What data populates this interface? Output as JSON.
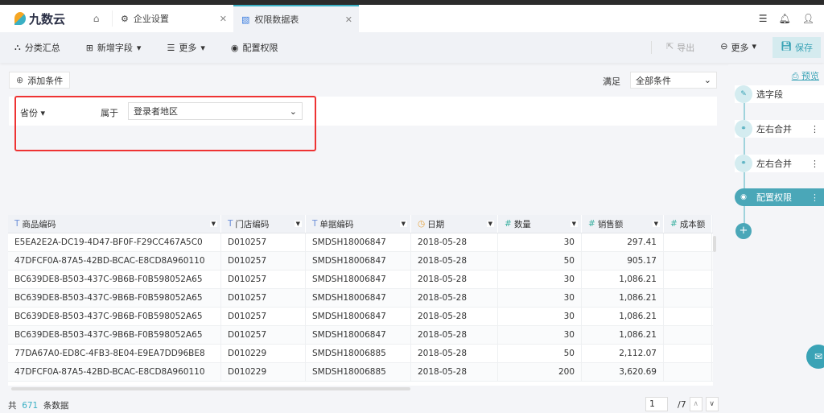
{
  "header": {
    "brand": "九数云",
    "tabs": [
      {
        "label": "企业设置",
        "icon": "gear-icon"
      },
      {
        "label": "权限数据表",
        "icon": "chart-icon",
        "active": true
      }
    ]
  },
  "toolbar": {
    "classify": "分类汇总",
    "add_field": "新增字段",
    "more": "更多",
    "config": "配置权限",
    "export": "导出",
    "more_right": "更多",
    "save": "保存"
  },
  "filter": {
    "add_condition": "添加条件",
    "satisfy": "满足",
    "satisfy_value": "全部条件",
    "field": "省份",
    "operator": "属于",
    "value": "登录者地区"
  },
  "table": {
    "columns": [
      {
        "label": "商品编码",
        "type": "text"
      },
      {
        "label": "门店编码",
        "type": "text"
      },
      {
        "label": "单据编码",
        "type": "text"
      },
      {
        "label": "日期",
        "type": "date"
      },
      {
        "label": "数量",
        "type": "number"
      },
      {
        "label": "销售额",
        "type": "number"
      },
      {
        "label": "成本额",
        "type": "number"
      }
    ],
    "rows": [
      [
        "E5EA2E2A-DC19-4D47-BF0F-F29CC467A5C0",
        "D010257",
        "SMDSH18006847",
        "2018-05-28",
        "30",
        "297.41",
        ""
      ],
      [
        "47DFCF0A-87A5-42BD-BCAC-E8CD8A960110",
        "D010257",
        "SMDSH18006847",
        "2018-05-28",
        "50",
        "905.17",
        ""
      ],
      [
        "BC639DE8-B503-437C-9B6B-F0B598052A65",
        "D010257",
        "SMDSH18006847",
        "2018-05-28",
        "30",
        "1,086.21",
        ""
      ],
      [
        "BC639DE8-B503-437C-9B6B-F0B598052A65",
        "D010257",
        "SMDSH18006847",
        "2018-05-28",
        "30",
        "1,086.21",
        ""
      ],
      [
        "BC639DE8-B503-437C-9B6B-F0B598052A65",
        "D010257",
        "SMDSH18006847",
        "2018-05-28",
        "30",
        "1,086.21",
        ""
      ],
      [
        "BC639DE8-B503-437C-9B6B-F0B598052A65",
        "D010257",
        "SMDSH18006847",
        "2018-05-28",
        "30",
        "1,086.21",
        ""
      ],
      [
        "77DA67A0-ED8C-4FB3-8E04-E9EA7DD96BE8",
        "D010229",
        "SMDSH18006885",
        "2018-05-28",
        "50",
        "2,112.07",
        ""
      ],
      [
        "47DFCF0A-87A5-42BD-BCAC-E8CD8A960110",
        "D010229",
        "SMDSH18006885",
        "2018-05-28",
        "200",
        "3,620.69",
        ""
      ]
    ]
  },
  "footer": {
    "prefix": "共",
    "count": "671",
    "suffix": "条数据",
    "page": "1",
    "total_pages": "/7"
  },
  "steps": {
    "preview": "预览",
    "items": [
      {
        "label": "选字段"
      },
      {
        "label": "左右合并"
      },
      {
        "label": "左右合并"
      },
      {
        "label": "配置权限",
        "active": true
      }
    ]
  },
  "colors": {
    "accent": "#3ab0c4",
    "highlight_border": "#e33333"
  }
}
